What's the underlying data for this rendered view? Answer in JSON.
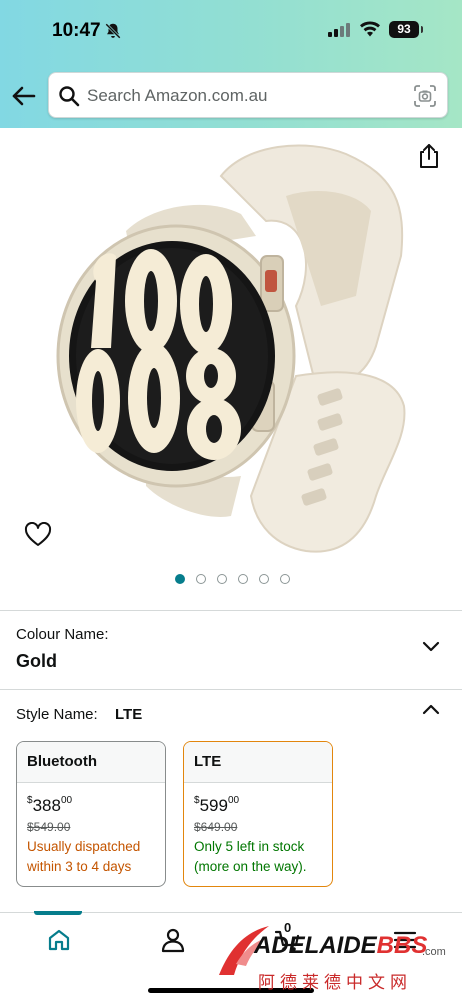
{
  "status_bar": {
    "time": "10:47",
    "battery": "93"
  },
  "search": {
    "placeholder": "Search Amazon.com.au"
  },
  "carousel": {
    "total_images": 6,
    "active_index": 0
  },
  "colour": {
    "label": "Colour Name:",
    "value": "Gold"
  },
  "style": {
    "label": "Style Name:",
    "value": "LTE",
    "options": [
      {
        "name": "Bluetooth",
        "currency": "$",
        "price_whole": "388",
        "price_fraction": "00",
        "old_price": "$549.00",
        "availability_line1": "Usually dispatched",
        "availability_line2": "within 3 to 4 days",
        "selected": false
      },
      {
        "name": "LTE",
        "currency": "$",
        "price_whole": "599",
        "price_fraction": "00",
        "old_price": "$649.00",
        "availability_line1": "Only 5 left in stock",
        "availability_line2": "(more on the way).",
        "selected": true
      }
    ]
  },
  "bottom_nav": {
    "cart_count": "0",
    "active": "home"
  },
  "watermark": {
    "brand_part1": "ADELAIDE",
    "brand_part2": "BBS",
    "domain": ".com",
    "chinese": "阿德莱德中文网"
  },
  "colors": {
    "accent": "#067d8c",
    "selected_border": "#e2860d",
    "orange_text": "#c45500",
    "green_text": "#007600"
  }
}
